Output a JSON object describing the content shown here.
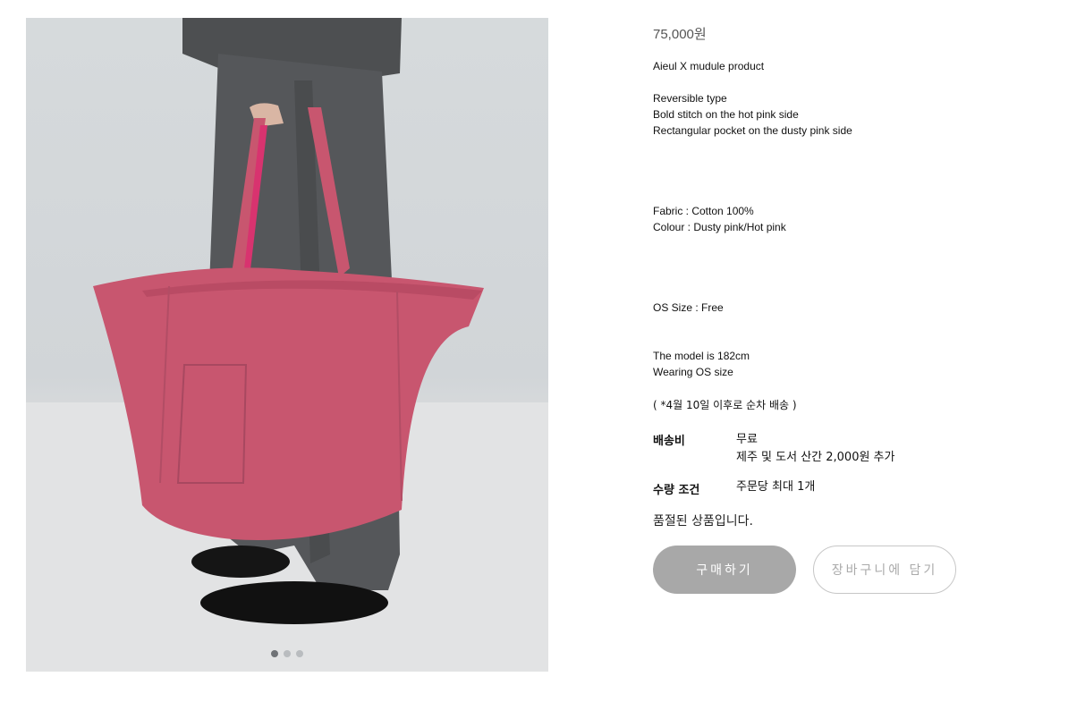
{
  "product": {
    "price": "75,000원",
    "description_lines": [
      "Aieul X mudule product",
      "Reversible type",
      "Bold stitch on the hot pink side",
      "Rectangular pocket on the dusty pink side",
      "Fabric : Cotton 100%",
      "Colour : Dusty pink/Hot pink",
      "OS Size : Free",
      "The model is 182cm",
      "Wearing OS size"
    ],
    "notice": "( *4월 10일 이후로 순차 배송 )"
  },
  "shipping": {
    "label": "배송비",
    "value": "무료",
    "extra": "제주 및 도서 산간 2,000원 추가"
  },
  "quantity": {
    "label": "수량 조건",
    "value": "주문당 최대 1개"
  },
  "status": "품절된 상품입니다.",
  "buttons": {
    "buy": "구매하기",
    "cart": "장바구니에 담기"
  },
  "gallery": {
    "image": "tote-bag-photo",
    "slides": 3,
    "active_slide": 1
  },
  "colors": {
    "bag": "#c8566f",
    "button_disabled": "#a8a8a8"
  }
}
